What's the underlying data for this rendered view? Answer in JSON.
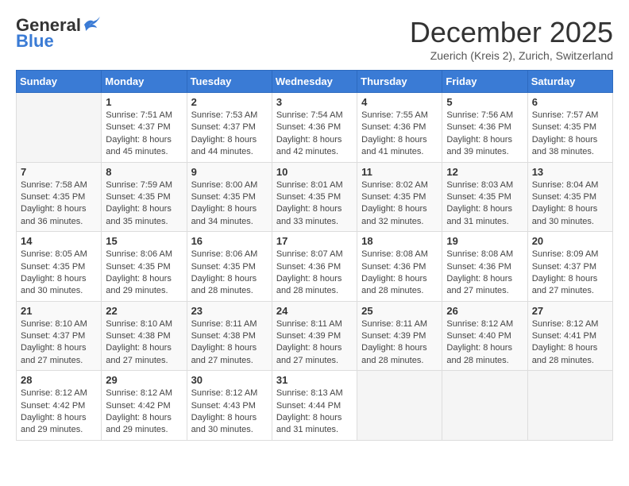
{
  "header": {
    "logo_general": "General",
    "logo_blue": "Blue",
    "month": "December 2025",
    "location": "Zuerich (Kreis 2), Zurich, Switzerland"
  },
  "weekdays": [
    "Sunday",
    "Monday",
    "Tuesday",
    "Wednesday",
    "Thursday",
    "Friday",
    "Saturday"
  ],
  "weeks": [
    [
      {
        "day": "",
        "info": ""
      },
      {
        "day": "1",
        "info": "Sunrise: 7:51 AM\nSunset: 4:37 PM\nDaylight: 8 hours\nand 45 minutes."
      },
      {
        "day": "2",
        "info": "Sunrise: 7:53 AM\nSunset: 4:37 PM\nDaylight: 8 hours\nand 44 minutes."
      },
      {
        "day": "3",
        "info": "Sunrise: 7:54 AM\nSunset: 4:36 PM\nDaylight: 8 hours\nand 42 minutes."
      },
      {
        "day": "4",
        "info": "Sunrise: 7:55 AM\nSunset: 4:36 PM\nDaylight: 8 hours\nand 41 minutes."
      },
      {
        "day": "5",
        "info": "Sunrise: 7:56 AM\nSunset: 4:36 PM\nDaylight: 8 hours\nand 39 minutes."
      },
      {
        "day": "6",
        "info": "Sunrise: 7:57 AM\nSunset: 4:35 PM\nDaylight: 8 hours\nand 38 minutes."
      }
    ],
    [
      {
        "day": "7",
        "info": "Sunrise: 7:58 AM\nSunset: 4:35 PM\nDaylight: 8 hours\nand 36 minutes."
      },
      {
        "day": "8",
        "info": "Sunrise: 7:59 AM\nSunset: 4:35 PM\nDaylight: 8 hours\nand 35 minutes."
      },
      {
        "day": "9",
        "info": "Sunrise: 8:00 AM\nSunset: 4:35 PM\nDaylight: 8 hours\nand 34 minutes."
      },
      {
        "day": "10",
        "info": "Sunrise: 8:01 AM\nSunset: 4:35 PM\nDaylight: 8 hours\nand 33 minutes."
      },
      {
        "day": "11",
        "info": "Sunrise: 8:02 AM\nSunset: 4:35 PM\nDaylight: 8 hours\nand 32 minutes."
      },
      {
        "day": "12",
        "info": "Sunrise: 8:03 AM\nSunset: 4:35 PM\nDaylight: 8 hours\nand 31 minutes."
      },
      {
        "day": "13",
        "info": "Sunrise: 8:04 AM\nSunset: 4:35 PM\nDaylight: 8 hours\nand 30 minutes."
      }
    ],
    [
      {
        "day": "14",
        "info": "Sunrise: 8:05 AM\nSunset: 4:35 PM\nDaylight: 8 hours\nand 30 minutes."
      },
      {
        "day": "15",
        "info": "Sunrise: 8:06 AM\nSunset: 4:35 PM\nDaylight: 8 hours\nand 29 minutes."
      },
      {
        "day": "16",
        "info": "Sunrise: 8:06 AM\nSunset: 4:35 PM\nDaylight: 8 hours\nand 28 minutes."
      },
      {
        "day": "17",
        "info": "Sunrise: 8:07 AM\nSunset: 4:36 PM\nDaylight: 8 hours\nand 28 minutes."
      },
      {
        "day": "18",
        "info": "Sunrise: 8:08 AM\nSunset: 4:36 PM\nDaylight: 8 hours\nand 28 minutes."
      },
      {
        "day": "19",
        "info": "Sunrise: 8:08 AM\nSunset: 4:36 PM\nDaylight: 8 hours\nand 27 minutes."
      },
      {
        "day": "20",
        "info": "Sunrise: 8:09 AM\nSunset: 4:37 PM\nDaylight: 8 hours\nand 27 minutes."
      }
    ],
    [
      {
        "day": "21",
        "info": "Sunrise: 8:10 AM\nSunset: 4:37 PM\nDaylight: 8 hours\nand 27 minutes."
      },
      {
        "day": "22",
        "info": "Sunrise: 8:10 AM\nSunset: 4:38 PM\nDaylight: 8 hours\nand 27 minutes."
      },
      {
        "day": "23",
        "info": "Sunrise: 8:11 AM\nSunset: 4:38 PM\nDaylight: 8 hours\nand 27 minutes."
      },
      {
        "day": "24",
        "info": "Sunrise: 8:11 AM\nSunset: 4:39 PM\nDaylight: 8 hours\nand 27 minutes."
      },
      {
        "day": "25",
        "info": "Sunrise: 8:11 AM\nSunset: 4:39 PM\nDaylight: 8 hours\nand 28 minutes."
      },
      {
        "day": "26",
        "info": "Sunrise: 8:12 AM\nSunset: 4:40 PM\nDaylight: 8 hours\nand 28 minutes."
      },
      {
        "day": "27",
        "info": "Sunrise: 8:12 AM\nSunset: 4:41 PM\nDaylight: 8 hours\nand 28 minutes."
      }
    ],
    [
      {
        "day": "28",
        "info": "Sunrise: 8:12 AM\nSunset: 4:42 PM\nDaylight: 8 hours\nand 29 minutes."
      },
      {
        "day": "29",
        "info": "Sunrise: 8:12 AM\nSunset: 4:42 PM\nDaylight: 8 hours\nand 29 minutes."
      },
      {
        "day": "30",
        "info": "Sunrise: 8:12 AM\nSunset: 4:43 PM\nDaylight: 8 hours\nand 30 minutes."
      },
      {
        "day": "31",
        "info": "Sunrise: 8:13 AM\nSunset: 4:44 PM\nDaylight: 8 hours\nand 31 minutes."
      },
      {
        "day": "",
        "info": ""
      },
      {
        "day": "",
        "info": ""
      },
      {
        "day": "",
        "info": ""
      }
    ]
  ]
}
